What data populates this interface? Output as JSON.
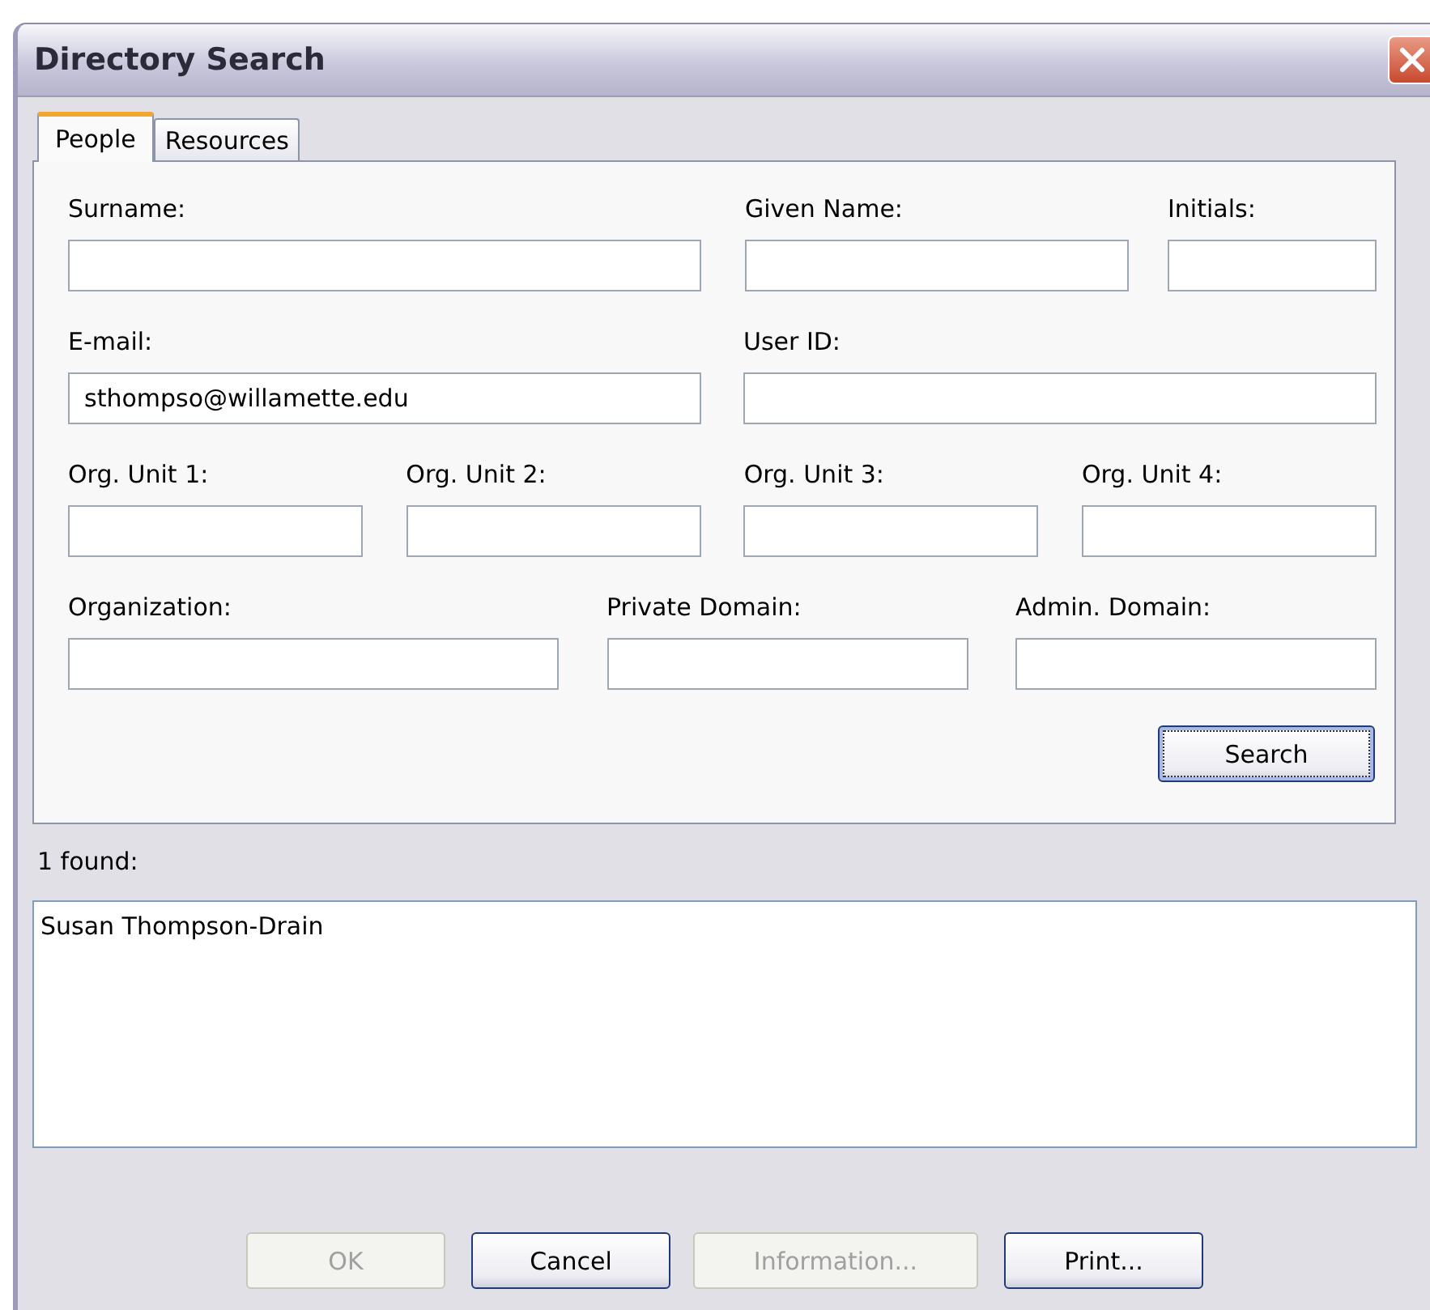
{
  "window": {
    "title": "Directory Search"
  },
  "tabs": [
    {
      "label": "People",
      "selected": true
    },
    {
      "label": "Resources",
      "selected": false
    }
  ],
  "field_rows": [
    [
      {
        "label": "Surname:"
      },
      {
        "label": "Given Name:"
      },
      {
        "label": "Initials:"
      }
    ],
    [
      {
        "label": "E-mail:",
        "value": "sthompso@willamette.edu"
      },
      {
        "label": "User ID:"
      }
    ],
    [
      {
        "label": "Org. Unit 1:"
      },
      {
        "label": "Org. Unit 2:"
      },
      {
        "label": "Org. Unit 3:"
      },
      {
        "label": "Org. Unit 4:"
      }
    ],
    [
      {
        "label": "Organization:"
      },
      {
        "label": "Private Domain:"
      },
      {
        "label": "Admin. Domain:"
      }
    ]
  ],
  "search_button": {
    "label": "Search",
    "focused": true
  },
  "results": {
    "count_label": "1 found:",
    "items": [
      "Susan Thompson-Drain"
    ]
  },
  "buttons": [
    {
      "label": "OK",
      "disabled": true
    },
    {
      "label": "Cancel",
      "disabled": false
    },
    {
      "label": "Information...",
      "disabled": true
    },
    {
      "label": "Print...",
      "disabled": false
    }
  ]
}
